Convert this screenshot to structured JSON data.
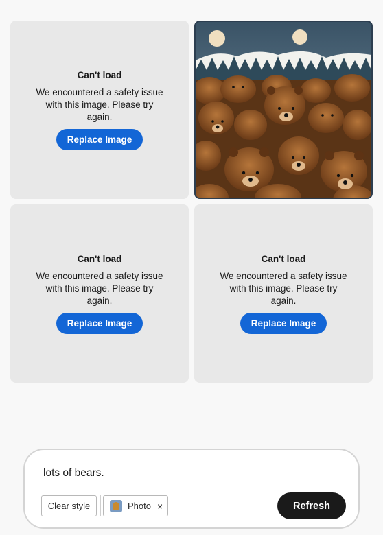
{
  "results": {
    "error_cards": [
      {
        "title": "Can't load",
        "message": "We encountered a safety issue with this image. Please try again.",
        "button": "Replace Image"
      },
      {
        "title": "Can't load",
        "message": "We encountered a safety issue with this image. Please try again.",
        "button": "Replace Image"
      },
      {
        "title": "Can't load",
        "message": "We encountered a safety issue with this image. Please try again.",
        "button": "Replace Image"
      }
    ],
    "generated_image": {
      "subject": "brown bears crowd with snowy forest and two moons"
    }
  },
  "prompt": {
    "text": "lots of bears.",
    "clear_style_label": "Clear style",
    "style_chip_label": "Photo",
    "style_chip_close": "×",
    "refresh_label": "Refresh"
  },
  "colors": {
    "accent": "#1366d6",
    "card_bg": "#e8e8e8",
    "page_bg": "#f8f8f8",
    "refresh_bg": "#1a1a1a"
  }
}
